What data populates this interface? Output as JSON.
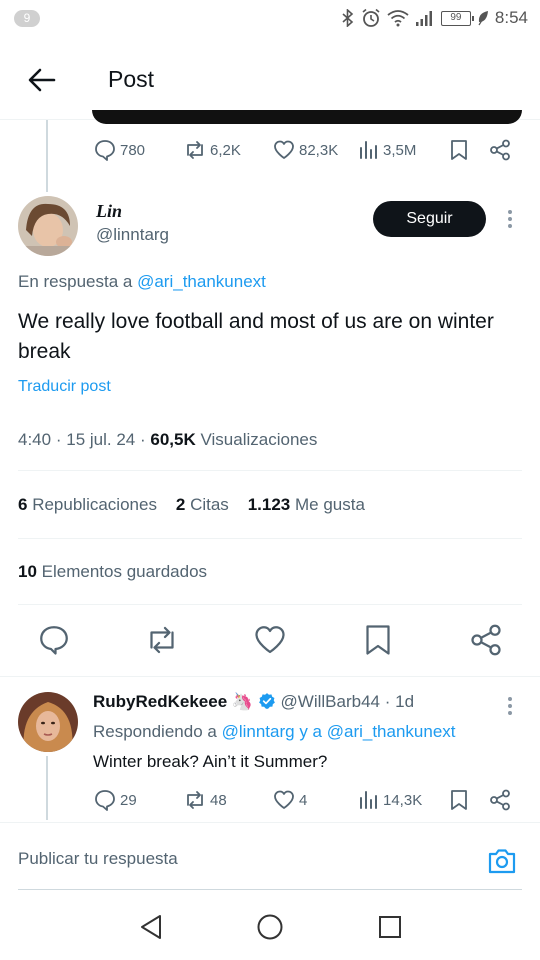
{
  "status_bar": {
    "notification_count": "9",
    "battery": "99",
    "time": "8:54"
  },
  "header": {
    "title": "Post"
  },
  "previous_post": {
    "replies": "780",
    "reposts": "6,2K",
    "likes": "82,3K",
    "views": "3,5M"
  },
  "main_post": {
    "author_name": "Lin",
    "author_handle": "@linntarg",
    "follow_label": "Seguir",
    "reply_prefix": "En respuesta a",
    "reply_to_handle": "@ari_thankunext",
    "text": "We really love football and most of us are on winter break",
    "translate_label": "Traducir post",
    "time": "4:40",
    "sep1": "·",
    "date": "15 jul. 24",
    "sep2": "·",
    "views_count": "60,5K",
    "views_label": "Visualizaciones",
    "reposts_count": "6",
    "reposts_label": "Republicaciones",
    "quotes_count": "2",
    "quotes_label": "Citas",
    "likes_count": "1.123",
    "likes_label": "Me gusta",
    "bookmarks_count": "10",
    "bookmarks_label": "Elementos guardados"
  },
  "reply": {
    "author_name": "RubyRedKekeee",
    "emoji": "🦄",
    "author_handle": "@WillBarb44",
    "age": "· 1d",
    "replying_prefix": "Respondiendo a",
    "replying_handle_1": "@linntarg",
    "replying_conj": "y a",
    "replying_handle_2": "@ari_thankunext",
    "text": "Winter break? Ain’t it Summer?",
    "replies": "29",
    "reposts": "48",
    "likes": "4",
    "views": "14,3K"
  },
  "compose": {
    "placeholder": "Publicar tu respuesta"
  },
  "colors": {
    "accent": "#1d9bf0",
    "text": "#0f1419",
    "muted": "#536471",
    "verified": "#1d9bf0"
  }
}
